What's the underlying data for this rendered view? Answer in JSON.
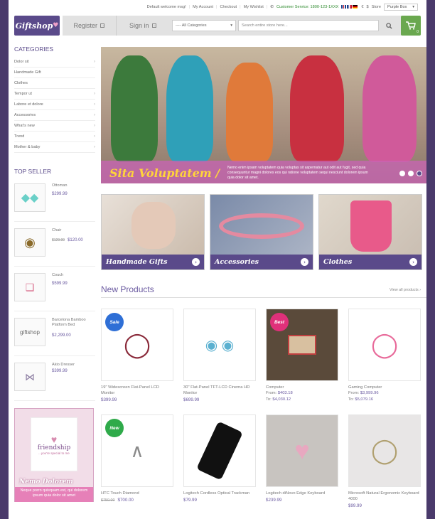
{
  "topbar": {
    "welcome": "Default welcome msg!",
    "my_account": "My Account",
    "checkout": "Checkout",
    "wishlist": "My Wishlist",
    "customer_service": "Customer Service: 1800-123-1XXX",
    "currencies": [
      "€",
      "$"
    ],
    "store_label": "Store",
    "store_value": "Purple Box"
  },
  "header": {
    "logo": "Giftshop",
    "register": "Register",
    "signin": "Sign in",
    "category_select": "---- All Categories",
    "search_placeholder": "Search entire store here...",
    "cart_count": "0"
  },
  "sidebar": {
    "categories_title": "CATEGORIES",
    "categories": [
      {
        "label": "Dolor sit",
        "chevron": true
      },
      {
        "label": "Handmade Gift",
        "chevron": false
      },
      {
        "label": "Clothes",
        "chevron": false
      },
      {
        "label": "Tempor ut",
        "chevron": true
      },
      {
        "label": "Labore et dolore",
        "chevron": true
      },
      {
        "label": "Accessories",
        "chevron": true
      },
      {
        "label": "What's new",
        "chevron": true
      },
      {
        "label": "Trend",
        "chevron": true
      },
      {
        "label": "Mother & baby",
        "chevron": true
      }
    ],
    "top_seller_title": "TOP SELLER",
    "top_sellers": [
      {
        "name": "Ottoman",
        "price": "$299.99",
        "old": ""
      },
      {
        "name": "Chair",
        "price": "$120.00",
        "old": "$129.99"
      },
      {
        "name": "Couch",
        "price": "$599.99",
        "old": ""
      },
      {
        "name": "Barcelona Bamboo Platform Bed",
        "price": "$2,299.00",
        "old": ""
      },
      {
        "name": "Akio Dresser",
        "price": "$399.99",
        "old": ""
      }
    ],
    "promo": {
      "card_word": "friendship",
      "card_tag": "...you're special to me",
      "title": "Nemo Dolorem",
      "desc": "Neque porro quisquam est, qui dolorem ipsum quia dolor sit amet"
    }
  },
  "slider": {
    "title": "Sita Voluptatem /",
    "desc": "Nemo enim ipsam voluptatem quia voluptas sit aspernatur aut odit aut fugit, sed quia consequuntur magni dolores eos qui ratione voluptatem sequi nesciunt dolorem ipsum quia dolor sit amet."
  },
  "tiles": [
    {
      "label": "Handmade Gifts"
    },
    {
      "label": "Accessories"
    },
    {
      "label": "Clothes"
    }
  ],
  "new_products": {
    "title": "New Products",
    "view_all": "View all products",
    "items": [
      {
        "name": "19\" Widescreen Flat-Panel LCD Monitor",
        "price": "$399.99",
        "badge": "Sale"
      },
      {
        "name": "30\" Flat-Panel TFT-LCD Cinema HD Monitor",
        "price": "$699.99",
        "badge": ""
      },
      {
        "name": "Computer",
        "from_label": "From:",
        "from": "$403.18",
        "to_label": "To:",
        "to": "$4,030.12",
        "badge": "Best"
      },
      {
        "name": "Gaming Computer",
        "from_label": "From:",
        "from": "$3,999.96",
        "to_label": "To:",
        "to": "$5,079.16",
        "badge": ""
      },
      {
        "name": "HTC Touch Diamond",
        "price": "$700.00",
        "old": "$750.00",
        "badge": "New"
      },
      {
        "name": "Logitech Cordless Optical Trackman",
        "price": "$79.99",
        "badge": ""
      },
      {
        "name": "Logitech diNovo Edge Keyboard",
        "price": "$239.99",
        "badge": ""
      },
      {
        "name": "Microsoft Natural Ergonomic Keyboard 4000",
        "price": "$99.99",
        "badge": ""
      }
    ]
  },
  "colors": {
    "brand": "#5a4a8a",
    "accent_pink": "#e680b8",
    "cart_green": "#6aa84f",
    "badge_sale": "#2f6fd6",
    "badge_best": "#e0307a",
    "badge_new": "#2faa4a"
  }
}
